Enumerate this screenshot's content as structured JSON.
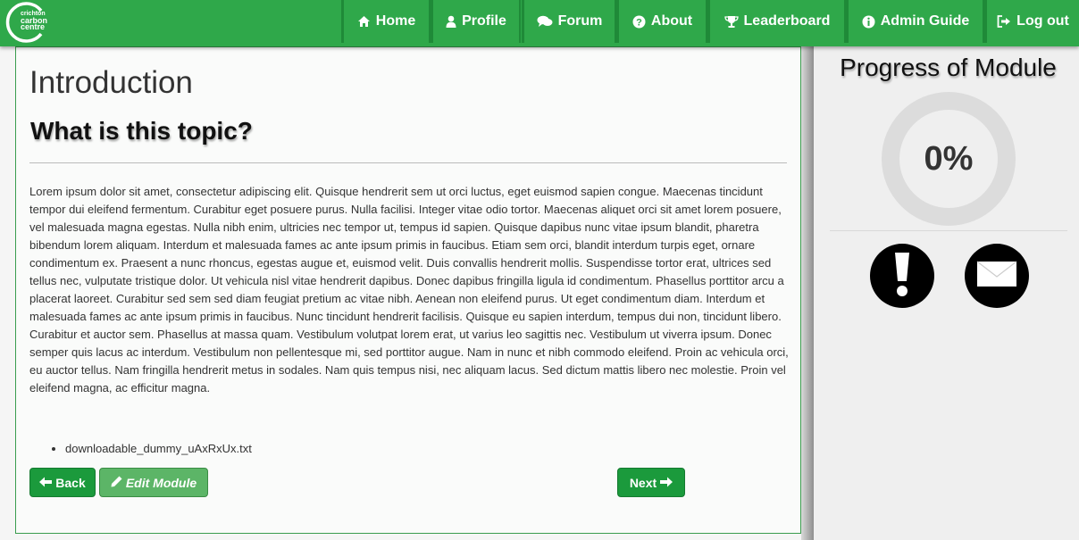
{
  "brand": {
    "logo_lines": [
      "crichton",
      "carbon",
      "centre"
    ]
  },
  "nav": {
    "items": [
      {
        "icon": "home-icon",
        "label": "Home"
      },
      {
        "icon": "user-icon",
        "label": "Profile"
      },
      {
        "icon": "comments-icon",
        "label": "Forum"
      },
      {
        "icon": "question-circle-icon",
        "label": "About"
      },
      {
        "icon": "trophy-icon",
        "label": "Leaderboard"
      },
      {
        "icon": "info-circle-icon",
        "label": "Admin Guide"
      },
      {
        "icon": "logout-icon",
        "label": "Log out"
      }
    ]
  },
  "module": {
    "title": "Introduction",
    "topic_heading": "What is this topic?",
    "body": "Lorem ipsum dolor sit amet, consectetur adipiscing elit. Quisque hendrerit sem ut orci luctus, eget euismod sapien congue. Maecenas tincidunt tempor dui eleifend fermentum. Curabitur eget posuere purus. Nulla facilisi. Integer vitae odio tortor. Maecenas aliquet orci sit amet lorem posuere, vel malesuada magna egestas. Nulla nibh enim, ultricies nec tempor ut, tempus id sapien. Quisque dapibus nunc vitae ipsum blandit, pharetra bibendum lorem aliquam. Interdum et malesuada fames ac ante ipsum primis in faucibus. Etiam sem orci, blandit interdum turpis eget, ornare condimentum ex. Praesent a nunc rhoncus, egestas augue et, euismod velit. Duis convallis hendrerit mollis. Suspendisse tortor erat, ultrices sed tellus nec, vulputate tristique dolor. Ut vehicula nisl vitae hendrerit dapibus. Donec dapibus fringilla ligula id condimentum. Phasellus porttitor arcu a placerat laoreet. Curabitur sed sem sed diam feugiat pretium ac vitae nibh. Aenean non eleifend purus. Ut eget condimentum diam. Interdum et malesuada fames ac ante ipsum primis in faucibus. Nunc tincidunt hendrerit facilisis. Quisque eu sapien interdum, tempus dui non, tincidunt libero. Curabitur et auctor sem. Phasellus at massa quam. Vestibulum volutpat lorem erat, ut varius leo sagittis nec. Vestibulum ut viverra ipsum. Donec semper quis lacus ac interdum. Vestibulum non pellentesque mi, sed porttitor augue. Nam in nunc et nibh commodo eleifend. Proin ac vehicula orci, eu auctor tellus. Nam fringilla hendrerit metus in sodales. Nam quis tempus nisi, nec aliquam lacus. Sed dictum mattis libero nec molestie. Proin vel eleifend magna, ac efficitur magna.",
    "downloads": [
      "downloadable_dummy_uAxRxUx.txt"
    ]
  },
  "buttons": {
    "back": "Back",
    "edit": "Edit Module",
    "next": "Next"
  },
  "sidebar": {
    "progress_title": "Progress of Module",
    "progress_value": "0%",
    "progress_fraction": 0,
    "alert_icon": "exclamation-icon",
    "mail_icon": "envelope-icon"
  },
  "colors": {
    "brand_green": "#2fa84a",
    "button_green": "#1b9a3c",
    "edit_green": "#5cb567"
  }
}
